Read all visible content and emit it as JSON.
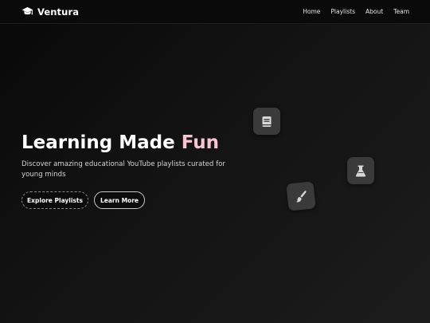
{
  "nav": {
    "brand_icon": "graduation-cap-icon",
    "brand_name": "Ventura",
    "links": [
      "Home",
      "Playlists",
      "About",
      "Team"
    ]
  },
  "hero": {
    "title_main": "Learning Made ",
    "title_accent": "Fun",
    "subtitle": "Discover amazing educational YouTube playlists curated for young minds",
    "primary_button": "Explore Playlists",
    "secondary_button": "Learn More"
  },
  "floating_icons": [
    "book-icon",
    "flask-icon",
    "paintbrush-icon"
  ],
  "colors": {
    "background": "#111111",
    "navbar": "#0a0a0a",
    "accent_text": "#f9c4d0",
    "card": "#3a3a3a",
    "icon": "#d8d8d8"
  }
}
